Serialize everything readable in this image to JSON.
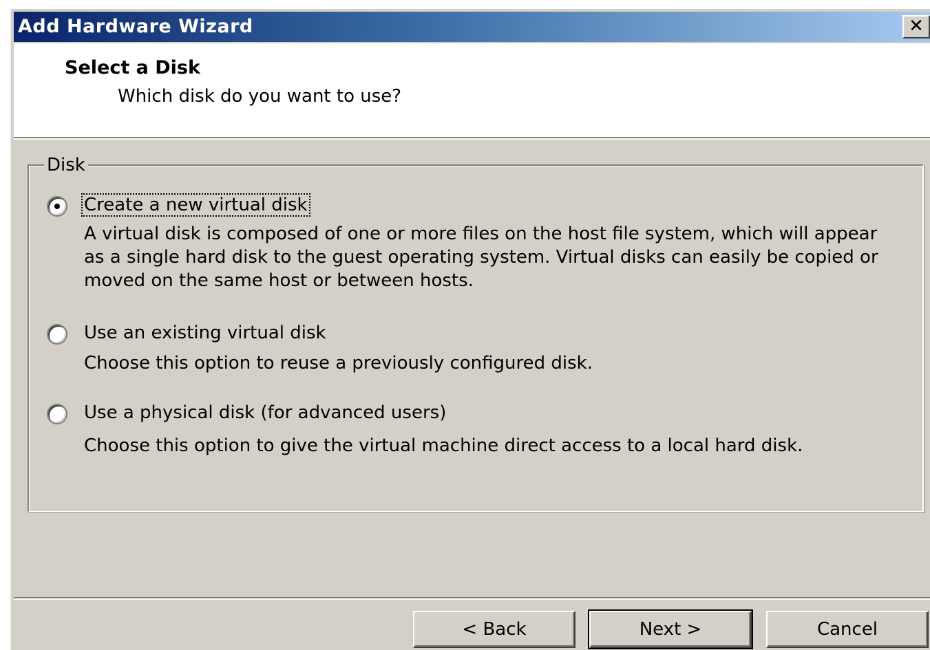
{
  "window": {
    "title": "Add Hardware Wizard",
    "close_label": "✕"
  },
  "header": {
    "title": "Select a Disk",
    "subtitle": "Which disk do you want to use?"
  },
  "group": {
    "legend": "Disk",
    "options": [
      {
        "label": "Create a new virtual disk",
        "selected": true,
        "description": "A virtual disk is composed of one or more files on the host file system, which will appear as a single hard disk to the guest operating system. Virtual disks can easily be copied or moved on the same host or between hosts."
      },
      {
        "label": "Use an existing virtual disk",
        "selected": false,
        "description": "Choose this option to reuse a previously configured disk."
      },
      {
        "label": "Use a physical disk (for advanced users)",
        "selected": false,
        "description": "Choose this option to give the virtual machine direct access to a local hard disk."
      }
    ]
  },
  "buttons": {
    "back": "< Back",
    "next": "Next >",
    "cancel": "Cancel"
  }
}
